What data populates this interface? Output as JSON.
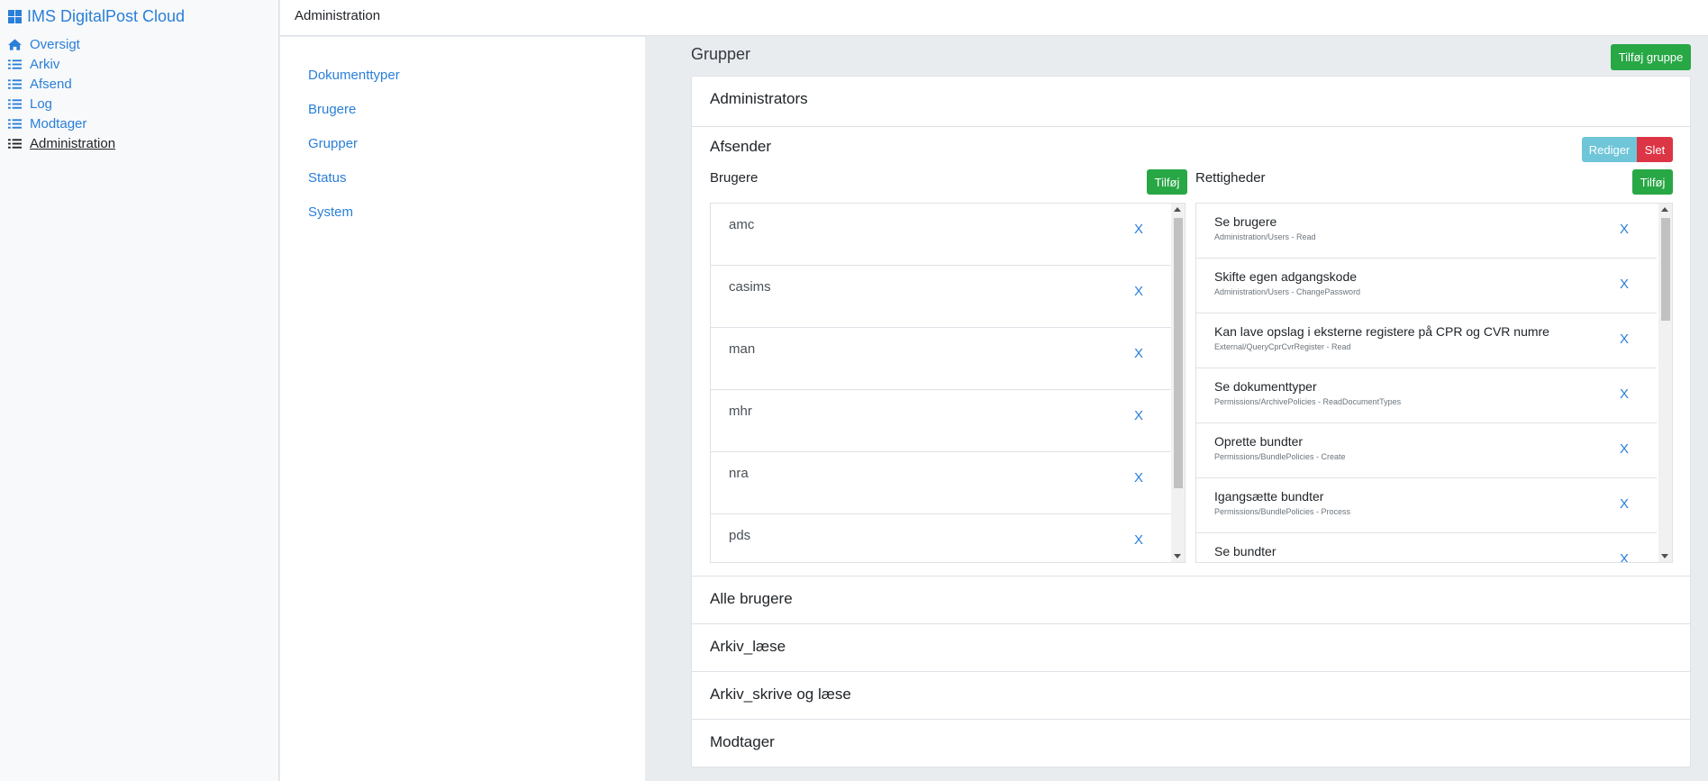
{
  "app": {
    "title": "IMS DigitalPost Cloud"
  },
  "sidebar": {
    "items": [
      {
        "label": "Oversigt",
        "icon": "home-icon"
      },
      {
        "label": "Arkiv",
        "icon": "list-icon"
      },
      {
        "label": "Afsend",
        "icon": "list-icon"
      },
      {
        "label": "Log",
        "icon": "list-icon"
      },
      {
        "label": "Modtager",
        "icon": "list-icon"
      },
      {
        "label": "Administration",
        "icon": "list-icon",
        "active": true
      }
    ]
  },
  "header": {
    "title": "Administration"
  },
  "submenu": {
    "items": [
      "Dokumenttyper",
      "Brugere",
      "Grupper",
      "Status",
      "System"
    ]
  },
  "main": {
    "title": "Grupper",
    "add_group_label": "Tilføj gruppe",
    "groups": {
      "first": "Administrators",
      "expanded": {
        "name": "Afsender",
        "edit_label": "Rediger",
        "delete_label": "Slet",
        "users_label": "Brugere",
        "users_add_label": "Tilføj",
        "rights_label": "Rettigheder",
        "rights_add_label": "Tilføj",
        "remove_label": "X",
        "users": [
          "amc",
          "casims",
          "man",
          "mhr",
          "nra",
          "pds"
        ],
        "rights": [
          {
            "name": "Se brugere",
            "code": "Administration/Users - Read"
          },
          {
            "name": "Skifte egen adgangskode",
            "code": "Administration/Users - ChangePassword"
          },
          {
            "name": "Kan lave opslag i eksterne registere på CPR og CVR numre",
            "code": "External/QueryCprCvrRegister - Read"
          },
          {
            "name": "Se dokumenttyper",
            "code": "Permissions/ArchivePolicies - ReadDocumentTypes"
          },
          {
            "name": "Oprette bundter",
            "code": "Permissions/BundlePolicies - Create"
          },
          {
            "name": "Igangsætte bundter",
            "code": "Permissions/BundlePolicies - Process"
          },
          {
            "name": "Se bundter",
            "code": ""
          }
        ]
      },
      "rest": [
        "Alle brugere",
        "Arkiv_læse",
        "Arkiv_skrive og læse",
        "Modtager"
      ]
    }
  },
  "colors": {
    "link": "#2a7fd8",
    "success": "#28a745",
    "info": "#6ec6d8",
    "danger": "#dc3545"
  }
}
